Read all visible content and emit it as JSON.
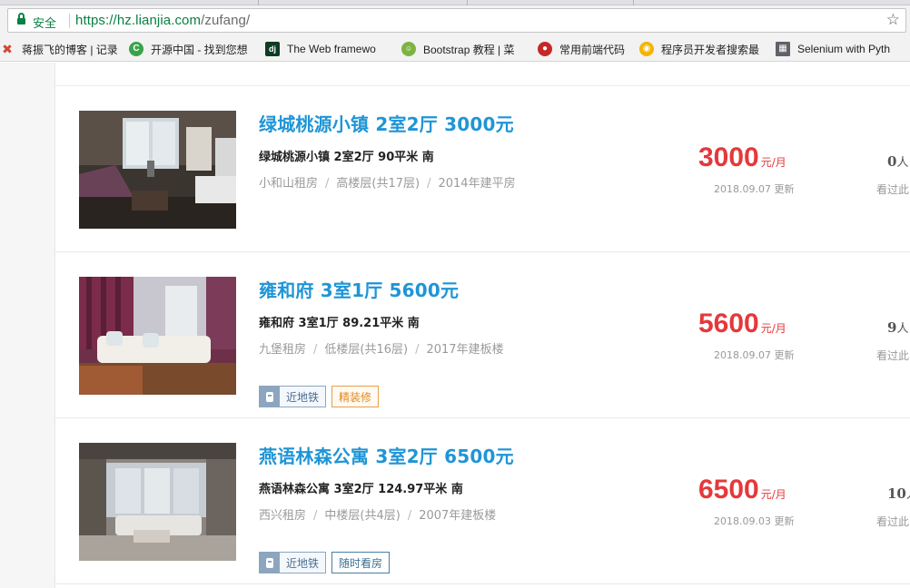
{
  "browser": {
    "secure_label": "安全",
    "url_host": "https://hz.lianjia.com",
    "url_path": "/zufang/",
    "star_icon": "star-icon"
  },
  "bookmarks": [
    {
      "label": "蒋振飞的博客 | 记录",
      "icon": "x-icon",
      "color": "#d34836"
    },
    {
      "label": "开源中国 - 找到您想",
      "icon": "oschina-icon",
      "color": "#3aa34a"
    },
    {
      "label": "The Web framewo",
      "icon": "django-icon",
      "color": "#0c3c26"
    },
    {
      "label": "Bootstrap 教程 | 菜",
      "icon": "runoob-icon",
      "color": "#7cb342"
    },
    {
      "label": "常用前端代码",
      "icon": "record-icon",
      "color": "#c62828"
    },
    {
      "label": "程序员开发者搜索最",
      "icon": "chrome-icon",
      "color": "#f4b400"
    },
    {
      "label": "Selenium with Pyth",
      "icon": "doc-icon",
      "color": "#5f6368"
    }
  ],
  "listings": [
    {
      "title": "绿城桃源小镇 2室2厅 3000元",
      "info": "绿城桃源小镇  2室2厅  90平米  南",
      "district": "小和山租房",
      "floor": "高楼层(共17层)",
      "year": "2014年建平房",
      "price": "3000",
      "unit": "元/月",
      "updated": "2018.09.07 更新",
      "viewers": "0",
      "viewers_unit": "人",
      "viewers_sub": "看过此",
      "tags": []
    },
    {
      "title": "雍和府 3室1厅 5600元",
      "info": "雍和府  3室1厅  89.21平米  南",
      "district": "九堡租房",
      "floor": "低楼层(共16层)",
      "year": "2017年建板楼",
      "price": "5600",
      "unit": "元/月",
      "updated": "2018.09.07 更新",
      "viewers": "9",
      "viewers_unit": "人",
      "viewers_sub": "看过此",
      "tags": [
        {
          "label": "近地铁",
          "kind": "subway"
        },
        {
          "label": "精装修",
          "kind": "deco"
        }
      ]
    },
    {
      "title": "燕语林森公寓 3室2厅 6500元",
      "info": "燕语林森公寓  3室2厅  124.97平米  南",
      "district": "西兴租房",
      "floor": "中楼层(共4层)",
      "year": "2007年建板楼",
      "price": "6500",
      "unit": "元/月",
      "updated": "2018.09.03 更新",
      "viewers": "10",
      "viewers_unit": "人",
      "viewers_sub": "看过此",
      "tags": [
        {
          "label": "近地铁",
          "kind": "subway"
        },
        {
          "label": "随时看房",
          "kind": "plain"
        }
      ]
    }
  ],
  "colors": {
    "title": "#1f95d6",
    "price": "#e4393c",
    "secure": "#0b8043"
  }
}
